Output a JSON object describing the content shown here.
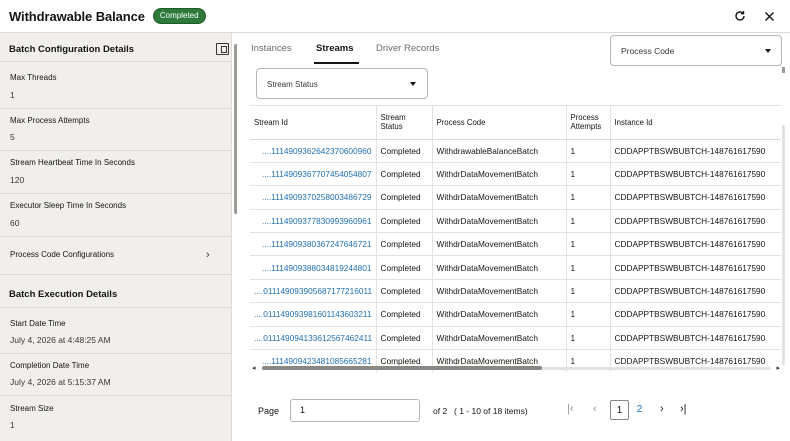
{
  "header": {
    "title": "Withdrawable Balance",
    "status_badge": "Completed"
  },
  "left_panel": {
    "batch_config": {
      "title": "Batch Configuration Details",
      "fields": [
        {
          "label": "Max Threads",
          "value": "1"
        },
        {
          "label": "Max Process Attempts",
          "value": "5"
        },
        {
          "label": "Stream Heartbeat Time In Seconds",
          "value": "120"
        },
        {
          "label": "Executor Sleep Time In Seconds",
          "value": "60"
        }
      ],
      "process_code_configurations": "Process Code Configurations"
    },
    "batch_execution": {
      "title": "Batch Execution Details",
      "fields": [
        {
          "label": "Start Date Time",
          "value": "July 4, 2026 at 4:48:25 AM"
        },
        {
          "label": "Completion Date Time",
          "value": "July 4, 2026 at 5:15:37 AM"
        },
        {
          "label": "Stream Size",
          "value": "1"
        }
      ]
    }
  },
  "tabs": [
    "Instances",
    "Streams",
    "Driver Records"
  ],
  "active_tab": "Streams",
  "process_code_filter": {
    "placeholder": "Process Code"
  },
  "stream_status_filter": {
    "placeholder": "Stream Status"
  },
  "table": {
    "columns": [
      "Stream Id",
      "Stream Status",
      "Process Code",
      "Process Attempts",
      "Instance Id"
    ],
    "rows": [
      [
        "....1114909362642370600960",
        "Completed",
        "WithdrawableBalanceBatch",
        "1",
        "CDDAPPTBSWBUBTCH-148761617590"
      ],
      [
        "....1114909367707454054807",
        "Completed",
        "WithdrDataMovementBatch",
        "1",
        "CDDAPPTBSWBUBTCH-148761617590"
      ],
      [
        "....1114909370258003486729",
        "Completed",
        "WithdrDataMovementBatch",
        "1",
        "CDDAPPTBSWBUBTCH-148761617590"
      ],
      [
        "....1114909377830993960961",
        "Completed",
        "WithdrDataMovementBatch",
        "1",
        "CDDAPPTBSWBUBTCH-148761617590"
      ],
      [
        "....1114909380367247646721",
        "Completed",
        "WithdrDataMovementBatch",
        "1",
        "CDDAPPTBSWBUBTCH-148761617590"
      ],
      [
        "....1114909388034819244801",
        "Completed",
        "WithdrDataMovementBatch",
        "1",
        "CDDAPPTBSWBUBTCH-148761617590"
      ],
      [
        "....011149093905687177216011",
        "Completed",
        "WithdrDataMovementBatch",
        "1",
        "CDDAPPTBSWBUBTCH-148761617590"
      ],
      [
        "....011149093981601143603211",
        "Completed",
        "WithdrDataMovementBatch",
        "1",
        "CDDAPPTBSWBUBTCH-148761617590"
      ],
      [
        "....011149094133612567462411",
        "Completed",
        "WithdrDataMovementBatch",
        "1",
        "CDDAPPTBSWBUBTCH-148761617590"
      ],
      [
        "....1114909423481085665281",
        "Completed",
        "WithdrDataMovementBatch",
        "1",
        "CDDAPPTBSWBUBTCH-148761617590"
      ]
    ]
  },
  "pagination": {
    "page_label": "Page",
    "page_value": "1",
    "of_text": "of 2",
    "items_text": "( 1 - 10 of 18 items)",
    "pages": [
      "1",
      "2"
    ],
    "current_page": "1"
  }
}
